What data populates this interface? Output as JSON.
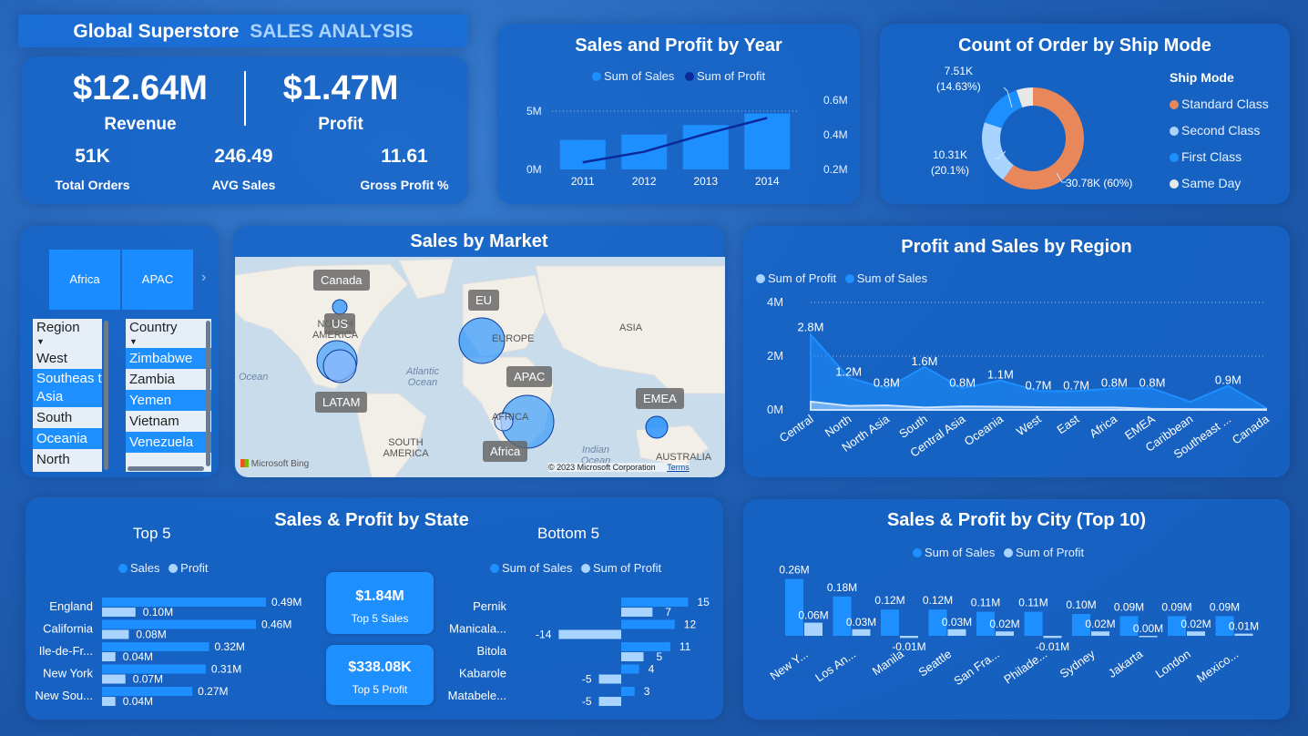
{
  "header": {
    "title_main": "Global Superstore",
    "title_accent": "SALES ANALYSIS"
  },
  "kpis": {
    "revenue": {
      "value": "$12.64M",
      "label": "Revenue"
    },
    "profit": {
      "value": "$1.47M",
      "label": "Profit"
    },
    "total_orders": {
      "value": "51K",
      "label": "Total Orders"
    },
    "avg_sales": {
      "value": "246.49",
      "label": "AVG Sales"
    },
    "gross_profit": {
      "value": "11.61",
      "label": "Gross Profit %"
    }
  },
  "colors": {
    "sales": "#1e8fff",
    "profit_dark": "#0a2a9c",
    "profit_light": "#a8d4ff",
    "orange": "#e8875a",
    "panel": "#1464c8"
  },
  "year_chart": {
    "title": "Sales and Profit by Year",
    "legend": [
      "Sum of Sales",
      "Sum of Profit"
    ],
    "y_left_ticks": [
      "5M",
      "0M"
    ],
    "y_right_ticks": [
      "0.6M",
      "0.4M",
      "0.2M"
    ],
    "chart_data": {
      "type": "bar+line",
      "categories": [
        "2011",
        "2012",
        "2013",
        "2014"
      ],
      "series": [
        {
          "name": "Sum of Sales",
          "values": [
            2.26,
            2.68,
            3.41,
            4.3
          ]
        },
        {
          "name": "Sum of Profit",
          "values": [
            0.25,
            0.31,
            0.41,
            0.5
          ]
        }
      ],
      "ylim_left": [
        0,
        7
      ],
      "ylim_right": [
        0.2,
        0.6
      ]
    }
  },
  "ship_chart": {
    "title": "Count of Order by Ship Mode",
    "legend_title": "Ship Mode",
    "legend": [
      "Standard Class",
      "Second Class",
      "First Class",
      "Same Day"
    ],
    "labels": [
      {
        "value": "30.78K (60%)"
      },
      {
        "value": "10.31K",
        "pct": "(20.1%)"
      },
      {
        "value": "7.51K",
        "pct": "(14.63%)"
      }
    ],
    "chart_data": {
      "type": "pie",
      "categories": [
        "Standard Class",
        "Second Class",
        "First Class",
        "Same Day"
      ],
      "values": [
        30.78,
        10.31,
        7.51,
        2.7
      ]
    }
  },
  "slicers": {
    "market_tiles": [
      "Africa",
      "APAC"
    ],
    "region_header": "Region",
    "regions": [
      {
        "label": "West",
        "selected": false
      },
      {
        "label": "Southeas t Asia",
        "selected": true
      },
      {
        "label": "South",
        "selected": false
      },
      {
        "label": "Oceania",
        "selected": true
      },
      {
        "label": "North",
        "selected": false
      }
    ],
    "country_header": "Country",
    "countries": [
      {
        "label": "Zimbabwe",
        "selected": true
      },
      {
        "label": "Zambia",
        "selected": false
      },
      {
        "label": "Yemen",
        "selected": true
      },
      {
        "label": "Vietnam",
        "selected": false
      },
      {
        "label": "Venezuela",
        "selected": true
      }
    ]
  },
  "market_map": {
    "title": "Sales by Market",
    "markets": [
      "Canada",
      "US",
      "EU",
      "APAC",
      "LATAM",
      "EMEA",
      "Africa"
    ],
    "geo": [
      "NORTH AMERICA",
      "EUROPE",
      "ASIA",
      "AFRICA",
      "SOUTH AMERICA",
      "AUSTRALIA"
    ],
    "oceans": [
      "Atlantic Ocean",
      "Indian Ocean",
      "Ocean"
    ],
    "attribution": "© 2023 Microsoft Corporation",
    "terms": "Terms",
    "brand": "Microsoft Bing"
  },
  "region_chart": {
    "title": "Profit and Sales by Region",
    "legend": [
      "Sum of Profit",
      "Sum of Sales"
    ],
    "y_ticks": [
      "4M",
      "2M",
      "0M"
    ],
    "data_labels": [
      "2.8M",
      "1.2M",
      "0.8M",
      "1.6M",
      "0.8M",
      "1.1M",
      "0.7M",
      "0.7M",
      "0.8M",
      "0.8M",
      "0.9M"
    ],
    "chart_data": {
      "type": "area",
      "categories": [
        "Central",
        "North",
        "North Asia",
        "South",
        "Central Asia",
        "Oceania",
        "West",
        "East",
        "Africa",
        "EMEA",
        "Caribbean",
        "Southeast ...",
        "Canada"
      ],
      "series": [
        {
          "name": "Sum of Sales",
          "values": [
            2.8,
            1.2,
            0.8,
            1.6,
            0.8,
            1.1,
            0.7,
            0.7,
            0.8,
            0.8,
            0.3,
            0.9,
            0.07
          ]
        },
        {
          "name": "Sum of Profit",
          "values": [
            0.31,
            0.15,
            0.17,
            0.09,
            0.13,
            0.12,
            0.1,
            0.09,
            0.09,
            0.04,
            0.03,
            0.02,
            0.02
          ]
        }
      ],
      "ylim": [
        0,
        4
      ]
    }
  },
  "state_chart": {
    "title": "Sales & Profit by State",
    "top_title": "Top 5",
    "top_legend": [
      "Sales",
      "Profit"
    ],
    "bottom_title": "Bottom 5",
    "bottom_legend": [
      "Sum of Sales",
      "Sum of Profit"
    ],
    "cards": [
      {
        "value": "$1.84M",
        "label": "Top 5 Sales"
      },
      {
        "value": "$338.08K",
        "label": "Top 5 Profit"
      }
    ],
    "top_chart_data": {
      "type": "bar",
      "categories": [
        "England",
        "California",
        "Ile-de-Fr...",
        "New York",
        "New Sou..."
      ],
      "series": [
        {
          "name": "Sales",
          "values": [
            0.49,
            0.46,
            0.32,
            0.31,
            0.27
          ],
          "labels": [
            "0.49M",
            "0.46M",
            "0.32M",
            "0.31M",
            "0.27M"
          ]
        },
        {
          "name": "Profit",
          "values": [
            0.1,
            0.08,
            0.04,
            0.07,
            0.04
          ],
          "labels": [
            "0.10M",
            "0.08M",
            "0.04M",
            "0.07M",
            "0.04M"
          ]
        }
      ]
    },
    "bottom_chart_data": {
      "type": "bar",
      "categories": [
        "Pernik",
        "Manicala...",
        "Bitola",
        "Kabarole",
        "Matabele..."
      ],
      "series": [
        {
          "name": "Sum of Sales",
          "values": [
            15,
            12,
            11,
            4,
            3
          ]
        },
        {
          "name": "Sum of Profit",
          "values": [
            7,
            -14,
            5,
            -5,
            -5
          ]
        }
      ]
    }
  },
  "city_chart": {
    "title": "Sales & Profit by City (Top 10)",
    "legend": [
      "Sum of Sales",
      "Sum of Profit"
    ],
    "chart_data": {
      "type": "bar",
      "categories": [
        "New Y...",
        "Los An...",
        "Manila",
        "Seattle",
        "San Fra...",
        "Philade...",
        "Sydney",
        "Jakarta",
        "London",
        "Mexico..."
      ],
      "series": [
        {
          "name": "Sum of Sales",
          "values": [
            0.26,
            0.18,
            0.12,
            0.12,
            0.11,
            0.11,
            0.1,
            0.09,
            0.09,
            0.09
          ],
          "labels": [
            "0.26M",
            "0.18M",
            "0.12M",
            "0.12M",
            "0.11M",
            "0.11M",
            "0.10M",
            "0.09M",
            "0.09M",
            "0.09M"
          ]
        },
        {
          "name": "Sum of Profit",
          "values": [
            0.06,
            0.03,
            -0.01,
            0.03,
            0.02,
            -0.01,
            0.02,
            0.0,
            0.02,
            0.01
          ],
          "labels": [
            "0.06M",
            "0.03M",
            "-0.01M",
            "0.03M",
            "0.02M",
            "-0.01M",
            "0.02M",
            "0.00M",
            "0.02M",
            "0.01M"
          ]
        }
      ]
    }
  }
}
